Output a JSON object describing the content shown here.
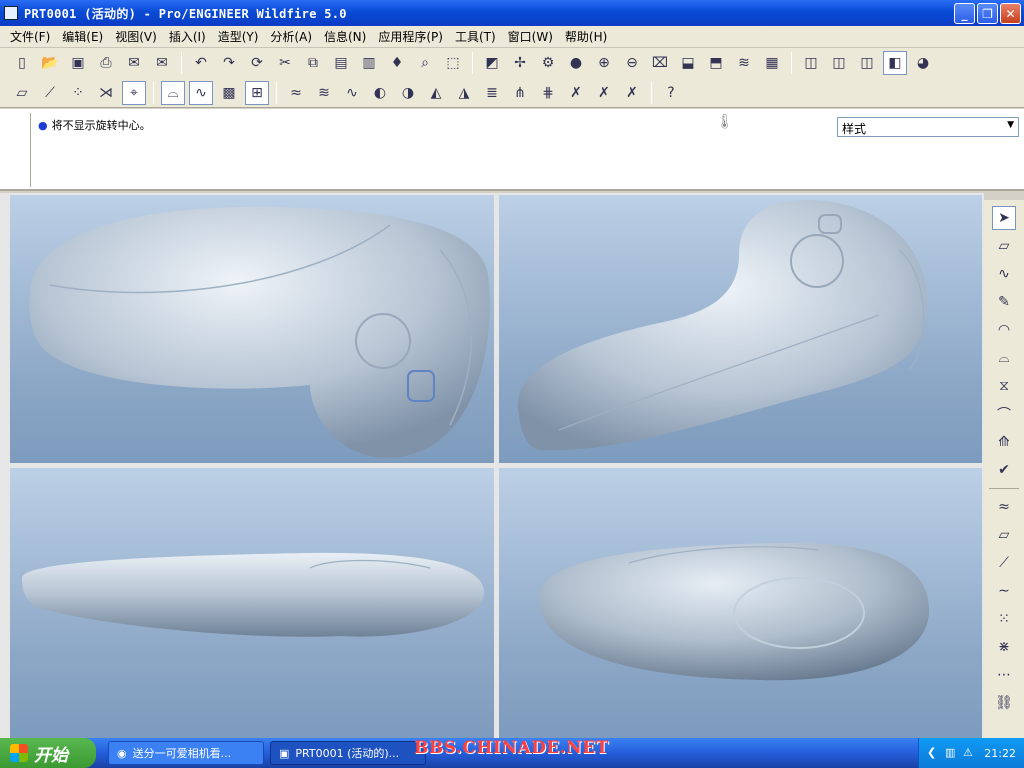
{
  "window": {
    "title": "PRT0001 (活动的) - Pro/ENGINEER Wildfire 5.0",
    "controls": {
      "minimize": "_",
      "maximize": "❐",
      "close": "✕"
    }
  },
  "menu": [
    {
      "label": "文件(F)"
    },
    {
      "label": "编辑(E)"
    },
    {
      "label": "视图(V)"
    },
    {
      "label": "插入(I)"
    },
    {
      "label": "造型(Y)"
    },
    {
      "label": "分析(A)"
    },
    {
      "label": "信息(N)"
    },
    {
      "label": "应用程序(P)"
    },
    {
      "label": "工具(T)"
    },
    {
      "label": "窗口(W)"
    },
    {
      "label": "帮助(H)"
    }
  ],
  "message": {
    "text": "将不显示旋转中心。"
  },
  "style_dropdown": {
    "value": "样式"
  },
  "taskbar": {
    "start_label": "开始",
    "items": [
      {
        "label": "送分一可爱相机看..."
      },
      {
        "label": "PRT0001 (活动的)..."
      }
    ],
    "watermark": "BBS.CHINADE.NET",
    "clock": "21:22"
  },
  "colors": {
    "viewport_top": "#bcd0e6",
    "viewport_bottom": "#7d9bbd",
    "model": "#c9d3dd",
    "titlebar": "#0a4bd6"
  },
  "icons": {
    "toolbar1": [
      "new-file-icon",
      "open-icon",
      "save-icon",
      "print-icon",
      "email-icon",
      "email2-icon",
      "undo-icon",
      "redo-icon",
      "regenerate-icon",
      "cut-icon",
      "copy-icon",
      "paste-icon",
      "paste-special-icon",
      "style-icon",
      "search-binoculars-icon",
      "select-box-icon",
      "repaint-icon",
      "spin-center-icon",
      "orient-icon",
      "shade-icon",
      "zoom-in-icon",
      "zoom-out-icon",
      "fit-icon",
      "view-icon",
      "saved-views-icon",
      "layers-icon",
      "model-tree-icon",
      "wireframe-icon",
      "hidden-line-icon",
      "no-hidden-icon",
      "shading-icon",
      "display-icon"
    ],
    "toolbar2": [
      "datum-plane-icon",
      "datum-axis-icon",
      "datum-point-icon",
      "coordinate-icon",
      "annotation-icon",
      "surface-a-icon",
      "surface-b-icon",
      "grid-icon",
      "sketch-grid-icon",
      "curve-a-icon",
      "curve-b-icon",
      "curve-c-icon",
      "analysis-color-icon",
      "analysis-shade-icon",
      "analysis-draft-icon",
      "analysis-reflect-icon",
      "analysis-section-icon",
      "analysis-offset-icon",
      "analysis-dihedral-icon",
      "analysis-delete-a-icon",
      "analysis-delete-b-icon",
      "analysis-delete-c-icon",
      "help-question-icon"
    ],
    "right": [
      "select-arrow-icon",
      "plane-icon",
      "curve-icon",
      "curve-edit-icon",
      "surface-icon",
      "surface-edit-icon",
      "connect-icon",
      "trim-icon",
      "offset-icon",
      "done-check-icon",
      "sketch-curve-icon",
      "parallelogram-icon",
      "line-icon",
      "spline-icon",
      "points-icon",
      "points-axis-icon",
      "grid-dots-icon",
      "link-icon"
    ]
  }
}
